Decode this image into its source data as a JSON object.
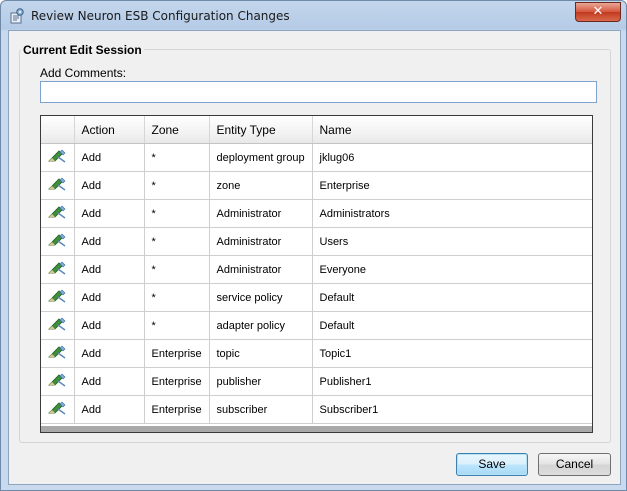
{
  "window": {
    "title": "Review Neuron ESB Configuration Changes",
    "close_label": "✕"
  },
  "session": {
    "group_title": "Current Edit Session",
    "comments_label": "Add Comments:",
    "comments_value": ""
  },
  "grid": {
    "columns": [
      "",
      "Action",
      "Zone",
      "Entity Type",
      "Name"
    ],
    "rows": [
      {
        "action": "Add",
        "zone": "*",
        "entity_type": "deployment group",
        "name": "jklug06"
      },
      {
        "action": "Add",
        "zone": "*",
        "entity_type": "zone",
        "name": "Enterprise"
      },
      {
        "action": "Add",
        "zone": "*",
        "entity_type": "Administrator",
        "name": "Administrators"
      },
      {
        "action": "Add",
        "zone": "*",
        "entity_type": "Administrator",
        "name": "Users"
      },
      {
        "action": "Add",
        "zone": "*",
        "entity_type": "Administrator",
        "name": "Everyone"
      },
      {
        "action": "Add",
        "zone": "*",
        "entity_type": "service policy",
        "name": "Default"
      },
      {
        "action": "Add",
        "zone": "*",
        "entity_type": "adapter policy",
        "name": "Default"
      },
      {
        "action": "Add",
        "zone": "Enterprise",
        "entity_type": "topic",
        "name": "Topic1"
      },
      {
        "action": "Add",
        "zone": "Enterprise",
        "entity_type": "publisher",
        "name": "Publisher1"
      },
      {
        "action": "Add",
        "zone": "Enterprise",
        "entity_type": "subscriber",
        "name": "Subscriber1"
      }
    ],
    "row_icon": "add-pencil-icon"
  },
  "buttons": {
    "save": "Save",
    "cancel": "Cancel"
  },
  "colors": {
    "close": "#c8462b",
    "accent": "#3c7fb1",
    "title_bar": "#b9cfe8"
  }
}
